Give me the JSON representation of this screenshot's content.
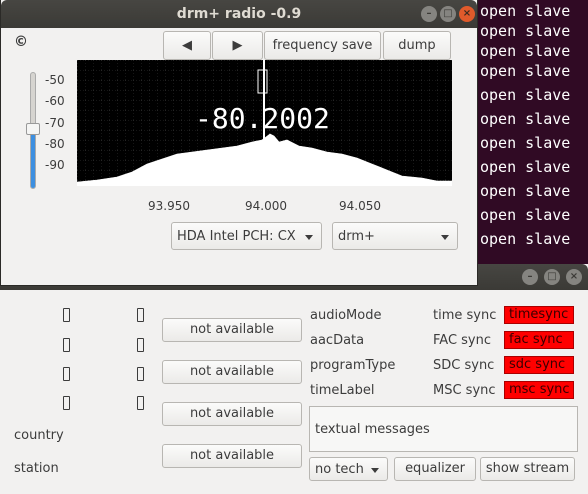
{
  "terminal": {
    "lines": [
      "open slave",
      "open slave",
      "open slave",
      "open slave",
      "open slave",
      "open slave",
      "open slave",
      "open slave",
      "open slave",
      "open slave",
      "open slave"
    ]
  },
  "main_window": {
    "title": "drm+ radio -0.9",
    "copyright": "©",
    "toolbar": {
      "prev": "◀",
      "next": "▶",
      "frequency_save": "frequency save",
      "dump": "dump"
    },
    "spectrum": {
      "readout": "-80.2002",
      "y_ticks": [
        "-50",
        "-60",
        "-70",
        "-80",
        "-90"
      ],
      "x_ticks": [
        "93.950",
        "94.000",
        "94.050"
      ]
    },
    "slider_value": "-70",
    "device_select": "HDA Intel PCH: CX",
    "mode_select": "drm+",
    "icons": {
      "min": "minimize-icon",
      "max": "maximize-icon",
      "close": "close-icon"
    }
  },
  "drm_panel": {
    "services": [
      "not available",
      "not available",
      "not available",
      "not available"
    ],
    "country_label": "country",
    "station_label": "station",
    "info_labels": [
      "audioMode",
      "aacData",
      "programType",
      "timeLabel"
    ],
    "sync_labels": [
      "time sync",
      "FAC sync",
      "SDC sync",
      "MSC sync"
    ],
    "sync_status": [
      "timesync",
      "fac  sync",
      "sdc sync",
      "msc sync"
    ],
    "textual_messages": "textual messages",
    "tech_select": "no tech",
    "equalizer": "equalizer",
    "show_stream": "show stream",
    "colors": {
      "sync_bad": "#ff0000"
    }
  }
}
